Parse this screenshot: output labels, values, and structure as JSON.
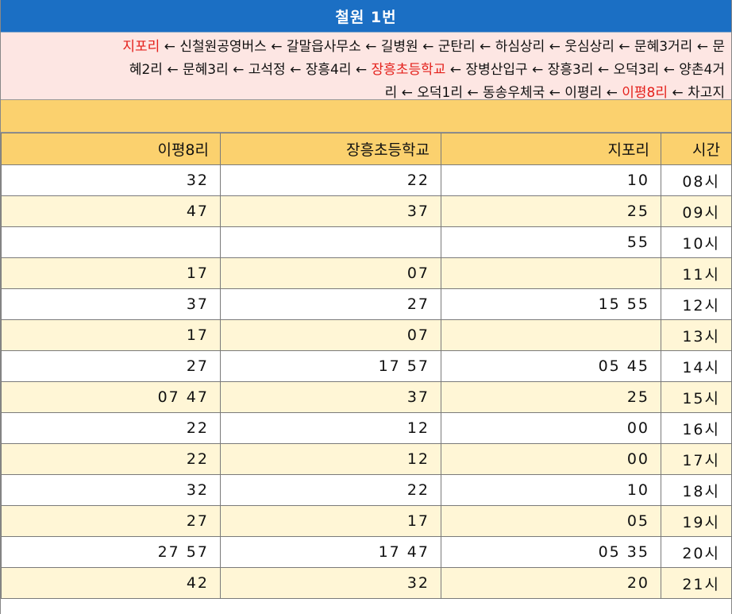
{
  "title": "철원 1번",
  "route": {
    "line1": [
      {
        "text": "지포리",
        "hl": true
      },
      {
        "text": " ← 신철원공영버스 ← 갈말읍사무소 ← 길병원 ← 군탄리 ← 하심상리 ← 웃심상리 ← 문혜3거리 ← 문",
        "hl": false
      }
    ],
    "line2": [
      {
        "text": "혜2리 ← 문혜3리 ← 고석정 ← 장흥4리 ← ",
        "hl": false
      },
      {
        "text": "장흥초등학교",
        "hl": true
      },
      {
        "text": " ← 장병산입구 ← 장흥3리 ← 오덕3리 ← 양촌4거",
        "hl": false
      }
    ],
    "line3": [
      {
        "text": "리 ← 오덕1리 ← 동송우체국 ← 이평리 ← ",
        "hl": false
      },
      {
        "text": "이평8리",
        "hl": true
      },
      {
        "text": " ← 차고지",
        "hl": false
      }
    ]
  },
  "table": {
    "headers": [
      "이평8리",
      "장흥초등학교",
      "지포리",
      "시간"
    ],
    "rows": [
      [
        "32",
        "22",
        "10",
        "08시"
      ],
      [
        "47",
        "37",
        "25",
        "09시"
      ],
      [
        "",
        "",
        "55",
        "10시"
      ],
      [
        "17",
        "07",
        "",
        "11시"
      ],
      [
        "37",
        "27",
        "15 55",
        "12시"
      ],
      [
        "17",
        "07",
        "",
        "13시"
      ],
      [
        "27",
        "17 57",
        "05 45",
        "14시"
      ],
      [
        "07 47",
        "37",
        "25",
        "15시"
      ],
      [
        "22",
        "12",
        "00",
        "16시"
      ],
      [
        "22",
        "12",
        "00",
        "17시"
      ],
      [
        "32",
        "22",
        "10",
        "18시"
      ],
      [
        "27",
        "17",
        "05",
        "19시"
      ],
      [
        "27 57",
        "17 47",
        "05 35",
        "20시"
      ],
      [
        "42",
        "32",
        "20",
        "21시"
      ]
    ]
  }
}
